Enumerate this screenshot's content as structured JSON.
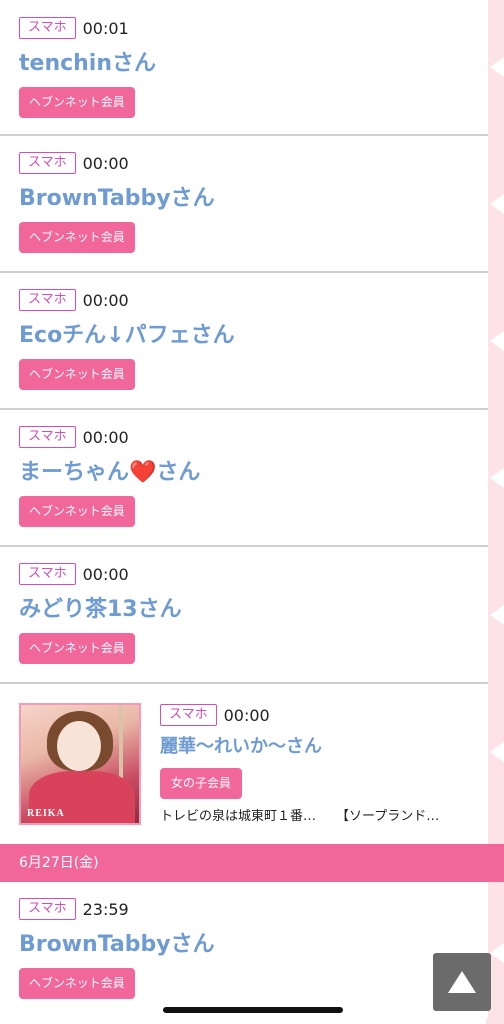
{
  "entries": [
    {
      "badge": "スマホ",
      "time": "00:01",
      "name": "tenchinさん",
      "member": "ヘブンネット会員"
    },
    {
      "badge": "スマホ",
      "time": "00:00",
      "name": "BrownTabbyさん",
      "member": "ヘブンネット会員"
    },
    {
      "badge": "スマホ",
      "time": "00:00",
      "name": "Ecoチん↓パフェさん",
      "member": "ヘブンネット会員"
    },
    {
      "badge": "スマホ",
      "time": "00:00",
      "name": "まーちゃん❤️さん",
      "member": "ヘブンネット会員"
    },
    {
      "badge": "スマホ",
      "time": "00:00",
      "name": "みどり茶13さん",
      "member": "ヘブンネット会員"
    }
  ],
  "girl_entry": {
    "badge": "スマホ",
    "time": "00:00",
    "name": "麗華〜れいか〜さん",
    "member": "女の子会員",
    "shop": "トレビの泉は城東町１番…",
    "category": "【ソープランド…",
    "photo_caption": "REIKA"
  },
  "date_header": "6月27日(金)",
  "next_entry": {
    "badge": "スマホ",
    "time": "23:59",
    "name": "BrownTabbyさん",
    "member": "ヘブンネット会員"
  },
  "icons": {
    "scroll_top": "up-triangle-icon"
  },
  "colors": {
    "accent_pink": "#f2679a",
    "name_blue": "#6f9bd3",
    "badge_purple": "#d24fb7"
  }
}
